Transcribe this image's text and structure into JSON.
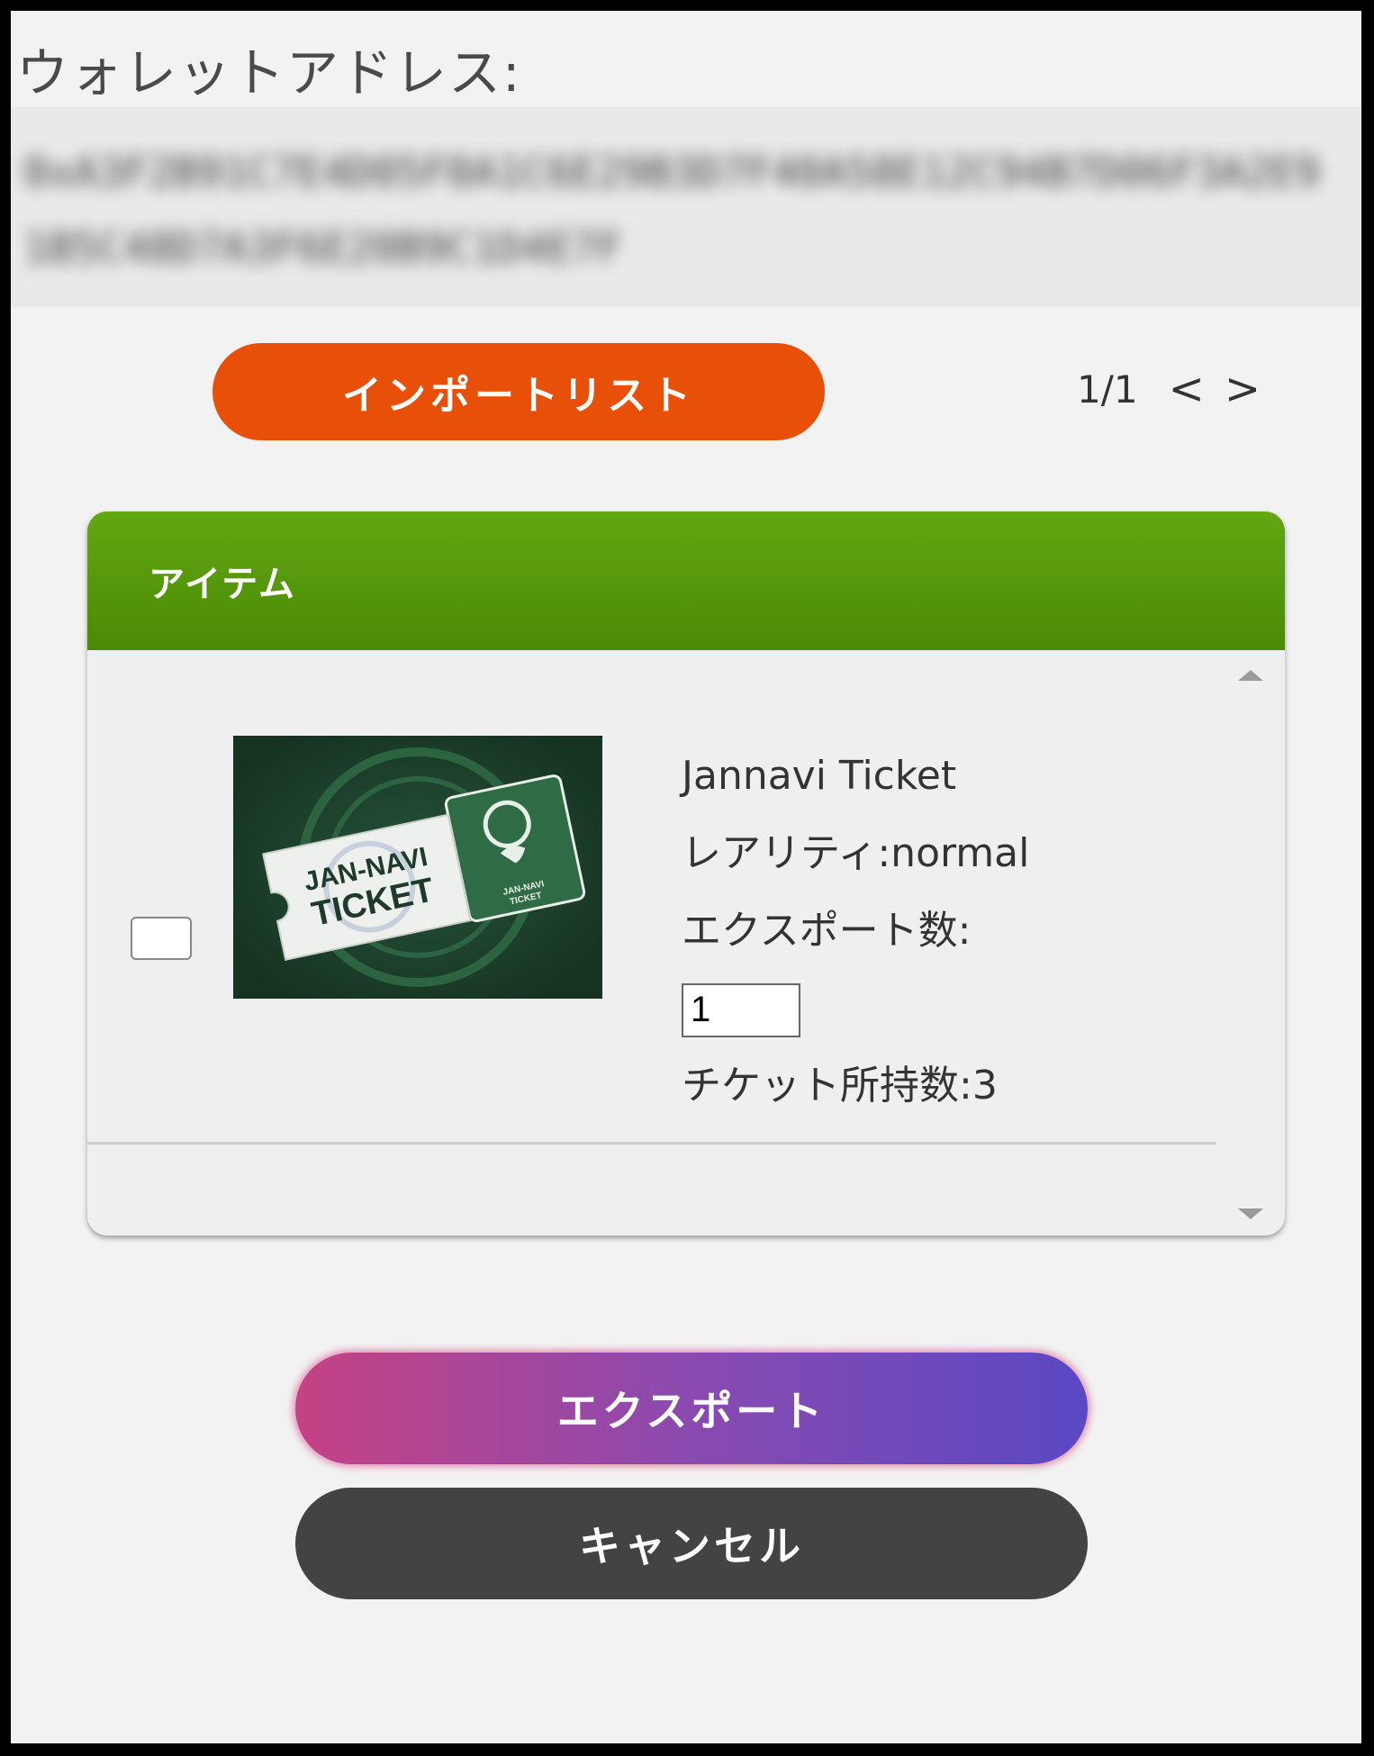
{
  "wallet": {
    "label": "ウォレットアドレス:",
    "address": "0xA3F2B91C7E4D05F8A1C6E29B3D7F40A58E12C94B7D06F3A2E91B5C48D7A3F6E20B9C1D4E7F"
  },
  "toolbar": {
    "import_label": "インポートリスト",
    "page": "1/1",
    "prev": "<",
    "next": ">"
  },
  "panel": {
    "header": "アイテム",
    "item": {
      "name": "Jannavi Ticket",
      "rarity": "レアリティ:normal",
      "export_count_label": "エクスポート数:",
      "export_count_value": "1",
      "owned": "チケット所持数:3",
      "image_text": [
        "JAN-NAVI",
        "TICKET"
      ],
      "image_small_text": [
        "JAN-NAVI",
        "TICKET"
      ]
    }
  },
  "actions": {
    "export_label": "エクスポート",
    "cancel_label": "キャンセル"
  },
  "colors": {
    "import_button": "#e8500a",
    "panel_header": "#5a9a0c",
    "cancel_button": "#434343",
    "export_gradient": [
      "#c54284",
      "#5a48c4"
    ]
  }
}
